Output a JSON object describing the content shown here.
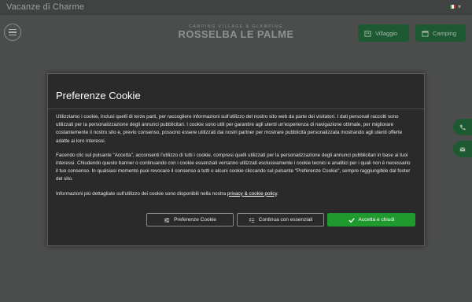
{
  "topbar": {
    "tagline": "Vacanze di Charme",
    "language": "IT"
  },
  "header": {
    "logo_sub": "CAMPING VILLAGE & GLAMPING",
    "logo_main": "ROSSELBA LE PALME",
    "buttons": [
      {
        "label": "Villaggio",
        "icon": "building-icon"
      },
      {
        "label": "Camping",
        "icon": "tent-icon"
      }
    ],
    "side_buttons": [
      {
        "icon": "phone-icon"
      },
      {
        "icon": "mail-icon"
      }
    ]
  },
  "cookie_modal": {
    "title": "Preferenze Cookie",
    "paragraph1": "Utilizziamo i cookie, inclusi quelli di terze parti, per raccogliere informazioni sull'utilizzo del nostro sito web da parte dei visitatori. I dati personali raccolti sono utilizzati per la personalizzazione degli annunci pubblicitari. I cookie sono utili per garantire agli utenti un'esperienza di navigazione ottimale, per migliorare costantemente il nostro sito e, previo consenso, possono essere utilizzati dai nostri partner per mostrare pubblicità personalizzata mostrando agli utenti offerte adatte ai loro interessi.",
    "paragraph2": "Facendo clic sul pulsante \"Accetta\", acconsenti l'utilizzo di tutti i cookie, compresi quelli utilizzati per la personalizzazione degli annunci pubblicitari in base ai tuoi interessi. Chiudendo questo banner o continuando con i cookie essenziali verranno utilizzati esclusivamente i cookie tecnici e analitici per i quali non è necessario il tuo consenso. In qualsiasi momento puoi revocare il consenso a tutti o alcuni cookie cliccando sul pulsante \"Preferenze Cookie\", sempre raggiungibile dal footer del sito.",
    "paragraph3_text": "Informazioni più dettagliate sull'utilizzo dei cookie sono disponibili nella nostra ",
    "paragraph3_link": "privacy & cookie policy",
    "paragraph3_end": ".",
    "buttons": {
      "preferences": "Preferenze Cookie",
      "essential": "Continua con essenziali",
      "accept": "Accetta e chiudi"
    }
  },
  "colors": {
    "accent_green": "#1f9a2e",
    "header_button_green": "#1d5a32",
    "modal_background": "#2a2a2a"
  }
}
